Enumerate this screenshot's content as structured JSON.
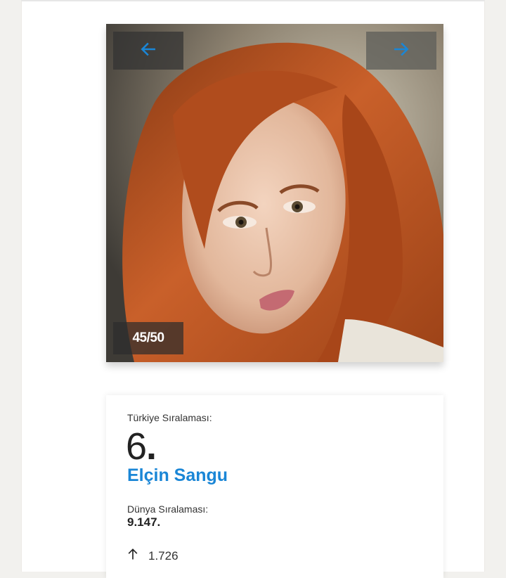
{
  "gallery": {
    "counter": "45/50",
    "prev_icon": "arrow-left-icon",
    "next_icon": "arrow-right-icon",
    "accent": "#1a86d6"
  },
  "ranking": {
    "turkey_label": "Türkiye Sıralaması:",
    "turkey_rank": "6",
    "turkey_rank_suffix": ".",
    "name": "Elçin Sangu",
    "world_label": "Dünya Sıralaması:",
    "world_rank": "9.147.",
    "change_icon": "arrow-up-icon",
    "change_value": "1.726"
  }
}
